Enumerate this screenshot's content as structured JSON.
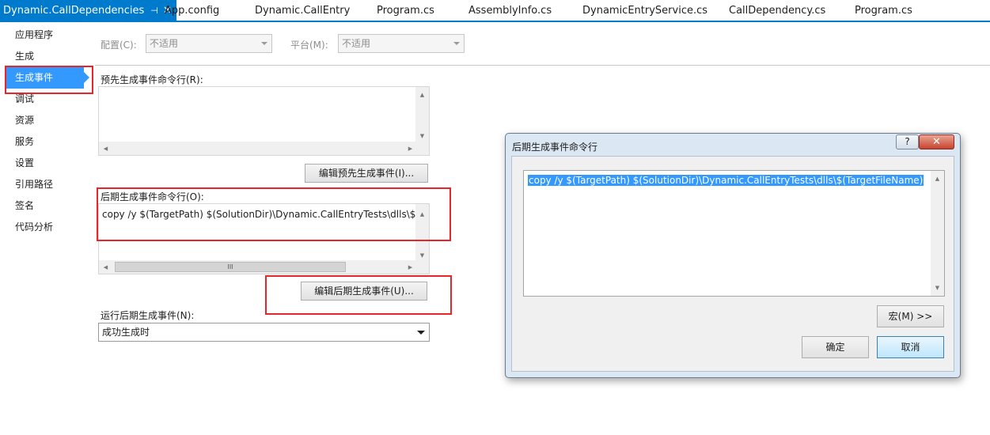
{
  "tabs": [
    {
      "label": "Dynamic.CallDependencies",
      "active": true
    },
    {
      "label": "App.config"
    },
    {
      "label": "Dynamic.CallEntry"
    },
    {
      "label": "Program.cs"
    },
    {
      "label": "AssemblyInfo.cs"
    },
    {
      "label": "DynamicEntryService.cs"
    },
    {
      "label": "CallDependency.cs"
    },
    {
      "label": "Program.cs"
    }
  ],
  "tab_icons": {
    "pin": "⊣",
    "close": "✕"
  },
  "sidebar": {
    "items": [
      {
        "label": "应用程序"
      },
      {
        "label": "生成"
      },
      {
        "label": "生成事件",
        "selected": true
      },
      {
        "label": "调试"
      },
      {
        "label": "资源"
      },
      {
        "label": "服务"
      },
      {
        "label": "设置"
      },
      {
        "label": "引用路径"
      },
      {
        "label": "签名"
      },
      {
        "label": "代码分析"
      }
    ]
  },
  "config": {
    "config_label": "配置(C):",
    "config_value": "不适用",
    "platform_label": "平台(M):",
    "platform_value": "不适用"
  },
  "prebuild": {
    "label": "预先生成事件命令行(R):",
    "value": "",
    "edit_button": "编辑预先生成事件(I)..."
  },
  "postbuild": {
    "label": "后期生成事件命令行(O):",
    "value": "copy /y $(TargetPath) $(SolutionDir)\\Dynamic.CallEntryTests\\dlls\\$(T",
    "edit_button": "编辑后期生成事件(U)...",
    "scroll_grip": "III"
  },
  "run_postbuild": {
    "label": "运行后期生成事件(N):",
    "value": "成功生成时"
  },
  "dialog": {
    "title": "后期生成事件命令行",
    "help": "?",
    "close": "✕",
    "command": "copy /y $(TargetPath) $(SolutionDir)\\Dynamic.CallEntryTests\\dlls\\$(TargetFileName)",
    "macro_button": "宏(M) >>",
    "ok_button": "确定",
    "cancel_button": "取消"
  },
  "colors": {
    "accent": "#007acc",
    "selection": "#3399ff",
    "highlight_box": "#e8262a"
  }
}
